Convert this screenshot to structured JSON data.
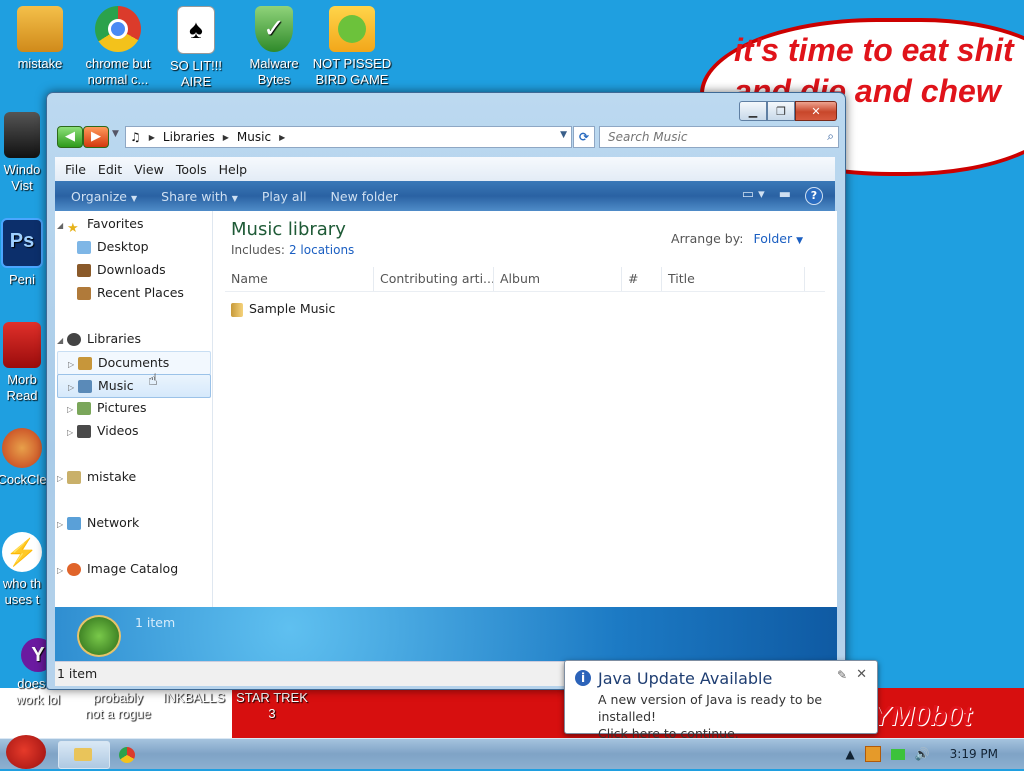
{
  "desktop": {
    "icons": [
      {
        "label": "mistake"
      },
      {
        "label": "chrome but\nnormal c..."
      },
      {
        "label": "SO LIT!!!\nAIRE"
      },
      {
        "label": "Malware\nBytes"
      },
      {
        "label": "NOT PISSED\nBIRD GAME"
      },
      {
        "label": "Windo\nVist"
      },
      {
        "label": "Peni"
      },
      {
        "label": "Morb\nRead"
      },
      {
        "label": "CockCle"
      },
      {
        "label": "who th\nuses t"
      },
      {
        "label": "doesn't\nwork lol"
      },
      {
        "label": "probably\nnot a rogue"
      },
      {
        "label": "INKBALLS"
      },
      {
        "label": "STAR TREK\n3"
      }
    ],
    "bubble_text": "it's time to eat shit\nand die and chew\ngum",
    "watermark": "YM0b0t",
    "colors": {
      "background": "#1f9fe0",
      "bubble_text": "#e0131a",
      "strip_red": "#d70f0f"
    }
  },
  "window": {
    "address": {
      "segments": [
        "Libraries",
        "Music"
      ]
    },
    "search": {
      "placeholder": "Search Music"
    },
    "menu": [
      "File",
      "Edit",
      "View",
      "Tools",
      "Help"
    ],
    "commands": {
      "organize": "Organize",
      "share": "Share with",
      "play_all": "Play all",
      "new_folder": "New folder"
    },
    "nav": {
      "favorites": "Favorites",
      "desktop": "Desktop",
      "downloads": "Downloads",
      "recent": "Recent Places",
      "libraries": "Libraries",
      "documents": "Documents",
      "music": "Music",
      "pictures": "Pictures",
      "videos": "Videos",
      "mistake": "mistake",
      "network": "Network",
      "image_catalog": "Image Catalog"
    },
    "content": {
      "title": "Music library",
      "includes_label": "Includes:",
      "includes_link": "2 locations",
      "arrange_label": "Arrange by:",
      "arrange_value": "Folder",
      "columns": [
        "Name",
        "Contributing arti...",
        "Album",
        "#",
        "Title"
      ],
      "items": [
        {
          "name": "Sample Music"
        }
      ]
    },
    "details_count": "1 item",
    "status": "1 item"
  },
  "notification": {
    "title": "Java Update Available",
    "body_line1": "A new version of Java is ready to be installed!",
    "body_line2": "Click here to continue."
  },
  "taskbar": {
    "clock": "3:19 PM"
  }
}
